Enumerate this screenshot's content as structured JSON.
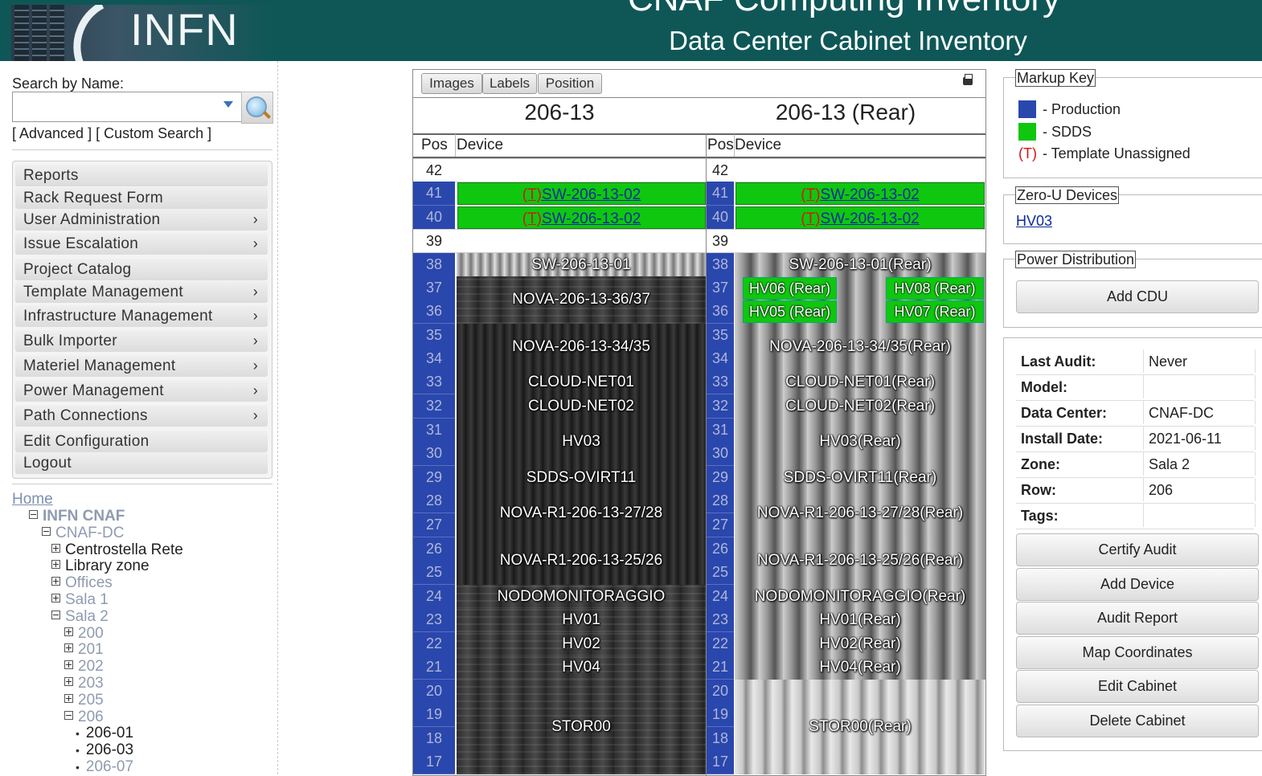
{
  "header": {
    "logo_text": "INFN",
    "app_title": "CNAF Computing Inventory",
    "page_subtitle": "Data Center Cabinet Inventory"
  },
  "sidebar": {
    "search_label": "Search by Name:",
    "search_value": "",
    "advanced_link": "[ Advanced ]",
    "custom_search_link": "[ Custom Search ]",
    "menu": [
      {
        "label": "Reports",
        "has_submenu": false
      },
      {
        "label": "Rack Request Form",
        "has_submenu": false
      },
      {
        "label": "User Administration",
        "has_submenu": true
      },
      {
        "label": "Issue Escalation",
        "has_submenu": true
      },
      {
        "label": "Project Catalog",
        "has_submenu": false
      },
      {
        "label": "Template Management",
        "has_submenu": true
      },
      {
        "label": "Infrastructure Management",
        "has_submenu": true
      },
      {
        "label": "Bulk Importer",
        "has_submenu": true
      },
      {
        "label": "Materiel Management",
        "has_submenu": true
      },
      {
        "label": "Power Management",
        "has_submenu": true
      },
      {
        "label": "Path Connections",
        "has_submenu": true
      },
      {
        "label": "Edit Configuration",
        "has_submenu": false
      },
      {
        "label": "Logout",
        "has_submenu": false
      }
    ],
    "chevron": "›",
    "tree": {
      "home": "Home",
      "nodes": [
        {
          "label": "INFN CNAF",
          "state": "open"
        },
        {
          "label": "CNAF-DC",
          "state": "open"
        },
        {
          "label": "Centrostella Rete",
          "state": "closed"
        },
        {
          "label": "Library zone",
          "state": "closed"
        },
        {
          "label": "Offices",
          "state": "closed"
        },
        {
          "label": "Sala 1",
          "state": "closed"
        },
        {
          "label": "Sala 2",
          "state": "open"
        },
        {
          "label": "200",
          "state": "closed"
        },
        {
          "label": "201",
          "state": "closed"
        },
        {
          "label": "202",
          "state": "closed"
        },
        {
          "label": "203",
          "state": "closed"
        },
        {
          "label": "205",
          "state": "closed"
        },
        {
          "label": "206",
          "state": "open"
        },
        {
          "label": "206-01",
          "state": "leaf"
        },
        {
          "label": "206-03",
          "state": "leaf"
        },
        {
          "label": "206-07",
          "state": "leaf"
        }
      ]
    }
  },
  "rack": {
    "tabs": [
      "Images",
      "Labels",
      "Position"
    ],
    "front_title": "206-13",
    "rear_title": "206-13 (Rear)",
    "col_pos": "Pos",
    "col_device": "Device",
    "positions": [
      "42",
      "41",
      "40",
      "39",
      "38",
      "37",
      "36",
      "35",
      "34",
      "33",
      "32",
      "31",
      "30",
      "29",
      "28",
      "27",
      "26",
      "25",
      "24",
      "23",
      "22",
      "21",
      "20",
      "19",
      "18",
      "17"
    ],
    "template_marker": "(T)",
    "front_devices": [
      {
        "label": "SW-206-13-02"
      },
      {
        "label": "SW-206-13-02"
      },
      {
        "label": "SW-206-13-01"
      },
      {
        "label": "NOVA-206-13-36/37"
      },
      {
        "label": "NOVA-206-13-34/35"
      },
      {
        "label": "CLOUD-NET01"
      },
      {
        "label": "CLOUD-NET02"
      },
      {
        "label": "HV03"
      },
      {
        "label": "SDDS-OVIRT11"
      },
      {
        "label": "NOVA-R1-206-13-27/28"
      },
      {
        "label": "NOVA-R1-206-13-25/26"
      },
      {
        "label": "NODOMONITORAGGIO"
      },
      {
        "label": "HV01"
      },
      {
        "label": "HV02"
      },
      {
        "label": "HV04"
      },
      {
        "label": "STOR00"
      }
    ],
    "rear_devices": [
      {
        "label": "SW-206-13-02"
      },
      {
        "label": "SW-206-13-02"
      },
      {
        "label": "SW-206-13-01(Rear)"
      },
      {
        "label": "HV06 (Rear)"
      },
      {
        "label": "HV08 (Rear)"
      },
      {
        "label": "HV05 (Rear)"
      },
      {
        "label": "HV07 (Rear)"
      },
      {
        "label": "NOVA-206-13-34/35(Rear)"
      },
      {
        "label": "CLOUD-NET01(Rear)"
      },
      {
        "label": "CLOUD-NET02(Rear)"
      },
      {
        "label": "HV03(Rear)"
      },
      {
        "label": "SDDS-OVIRT11(Rear)"
      },
      {
        "label": "NOVA-R1-206-13-27/28(Rear)"
      },
      {
        "label": "NOVA-R1-206-13-25/26(Rear)"
      },
      {
        "label": "NODOMONITORAGGIO(Rear)"
      },
      {
        "label": "HV01(Rear)"
      },
      {
        "label": "HV02(Rear)"
      },
      {
        "label": "HV04(Rear)"
      },
      {
        "label": "STOR00(Rear)"
      }
    ]
  },
  "right_panel": {
    "markup_key_title": "Markup Key",
    "key_production": "- Production",
    "key_sdds": "- SDDS",
    "key_template_marker": "(T)",
    "key_template": "- Template Unassigned",
    "colors": {
      "production": "#2a47ad",
      "sdds": "#0fc70f",
      "template": "#d41515",
      "header_bg": "#0f5757"
    },
    "zero_u_title": "Zero-U Devices",
    "zero_u_device": "HV03",
    "power_title": "Power Distribution",
    "add_cdu": "Add CDU",
    "info": [
      {
        "key": "Last Audit:",
        "value": "Never"
      },
      {
        "key": "Model:",
        "value": ""
      },
      {
        "key": "Data Center:",
        "value": "CNAF-DC"
      },
      {
        "key": "Install Date:",
        "value": "2021-06-11"
      },
      {
        "key": "Zone:",
        "value": "Sala 2"
      },
      {
        "key": "Row:",
        "value": "206"
      },
      {
        "key": "Tags:",
        "value": ""
      }
    ],
    "buttons": [
      "Certify Audit",
      "Add Device",
      "Audit Report",
      "Map Coordinates",
      "Edit Cabinet",
      "Delete Cabinet"
    ]
  }
}
